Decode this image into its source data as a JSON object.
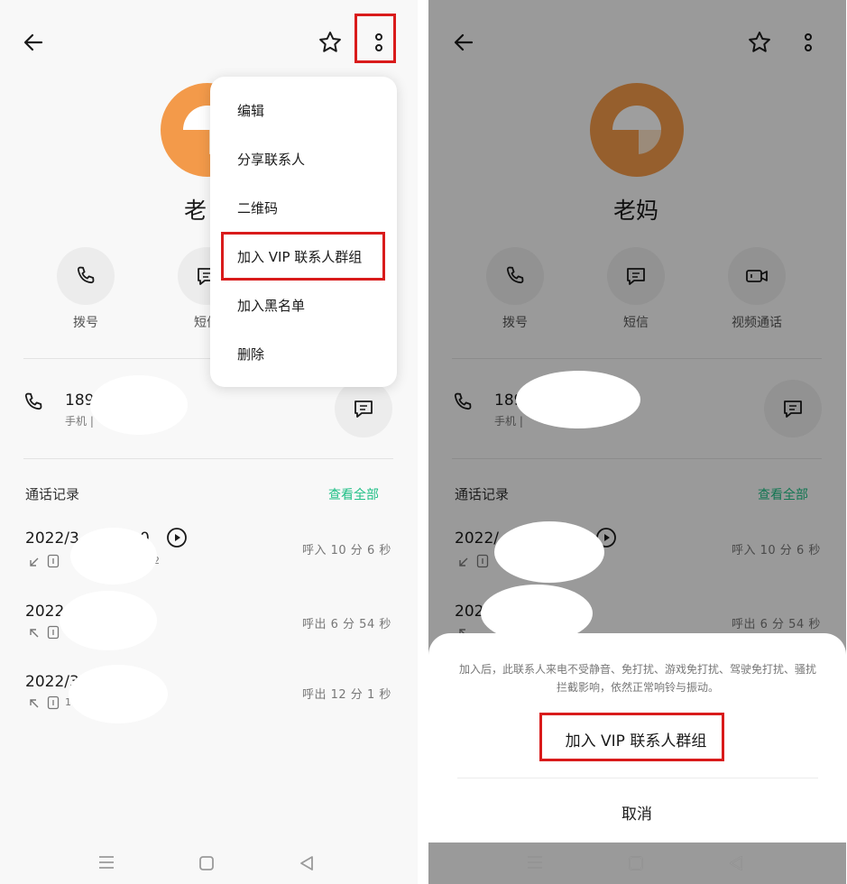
{
  "left": {
    "contact_name_partial": "老",
    "actions": {
      "call_label": "拨号",
      "sms_label_partial": "短信"
    },
    "phone": {
      "number_partial": "189",
      "type_partial": "手机 |"
    },
    "call_log": {
      "title": "通话记录",
      "see_all": "查看全部",
      "records": [
        {
          "date": "2022/3",
          "date_tail": "0",
          "sub_tail": "2",
          "info": "呼入  10 分 6 秒"
        },
        {
          "date": "2022",
          "info": "呼出  6 分 54 秒"
        },
        {
          "date": "2022/3",
          "sub_tail": "1",
          "info": "呼出  12 分 1 秒"
        }
      ]
    },
    "menu": {
      "items": [
        "编辑",
        "分享联系人",
        "二维码",
        "加入 VIP 联系人群组",
        "加入黑名单",
        "删除"
      ]
    }
  },
  "right": {
    "contact_name": "老妈",
    "actions": {
      "call_label": "拨号",
      "sms_label": "短信",
      "video_label": "视频通话"
    },
    "phone": {
      "number_partial": "189",
      "type_partial": "手机 |"
    },
    "call_log": {
      "title": "通话记录",
      "see_all": "查看全部",
      "records": [
        {
          "date": "2022/",
          "info": "呼入  10 分 6 秒"
        },
        {
          "date": "202",
          "info": "呼出  6 分 54 秒"
        }
      ]
    },
    "sheet": {
      "description": "加入后，此联系人来电不受静音、免打扰、游戏免打扰、驾驶免打扰、骚扰拦截影响，依然正常响铃与振动。",
      "confirm_label": "加入 VIP 联系人群组",
      "cancel_label": "取消"
    }
  },
  "colors": {
    "accent_green": "#1fbf86",
    "avatar_orange": "#f39a4a",
    "highlight_red": "#d91b1b"
  }
}
